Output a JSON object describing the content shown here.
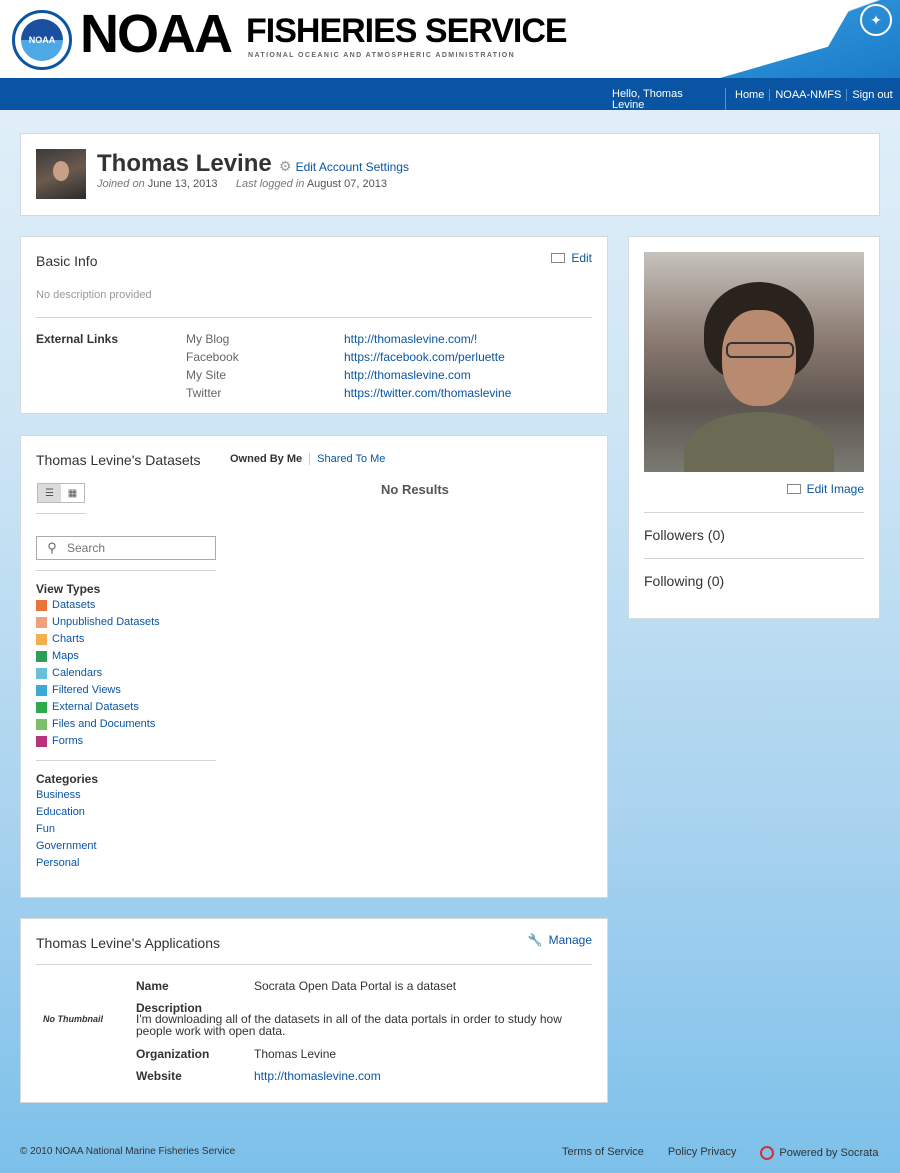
{
  "header": {
    "logo_text": "NOAA",
    "brand_main": "NOAA",
    "brand_secondary": "FISHERIES SERVICE",
    "brand_sub": "NATIONAL OCEANIC AND ATMOSPHERIC ADMINISTRATION"
  },
  "nav": {
    "greeting": "Hello, Thomas Levine",
    "links": [
      "Home",
      "NOAA-NMFS",
      "Sign out"
    ]
  },
  "profile": {
    "name": "Thomas Levine",
    "edit_account": "Edit Account Settings",
    "joined_label": "Joined on",
    "joined_date": "June 13, 2013",
    "last_logged_label": "Last logged in",
    "last_logged_date": "August 07, 2013"
  },
  "basic_info": {
    "title": "Basic Info",
    "edit_label": "Edit",
    "description": "No description provided",
    "external_links_label": "External Links",
    "links": [
      {
        "name": "My Blog",
        "url": "http://thomaslevine.com/!"
      },
      {
        "name": "Facebook",
        "url": "https://facebook.com/perluette"
      },
      {
        "name": "My Site",
        "url": "http://thomaslevine.com"
      },
      {
        "name": "Twitter",
        "url": "https://twitter.com/thomaslevine"
      }
    ]
  },
  "datasets": {
    "title": "Thomas Levine's Datasets",
    "tabs": [
      "Owned By Me",
      "Shared To Me"
    ],
    "no_results": "No Results",
    "search_placeholder": "Search",
    "view_types_label": "View Types",
    "view_types": [
      {
        "label": "Datasets",
        "color": "#e8743b",
        "icon": "grid-icon"
      },
      {
        "label": "Unpublished Datasets",
        "color": "#f0a07a",
        "icon": "draft-icon"
      },
      {
        "label": "Charts",
        "color": "#f4b04f",
        "icon": "chart-icon"
      },
      {
        "label": "Maps",
        "color": "#2e9e5b",
        "icon": "map-icon"
      },
      {
        "label": "Calendars",
        "color": "#6bbfd9",
        "icon": "calendar-icon"
      },
      {
        "label": "Filtered Views",
        "color": "#3fa9d6",
        "icon": "filter-icon"
      },
      {
        "label": "External Datasets",
        "color": "#2fa84f",
        "icon": "external-icon"
      },
      {
        "label": "Files and Documents",
        "color": "#7bbf6a",
        "icon": "file-icon"
      },
      {
        "label": "Forms",
        "color": "#b7337a",
        "icon": "form-icon"
      }
    ],
    "categories_label": "Categories",
    "categories": [
      "Business",
      "Education",
      "Fun",
      "Government",
      "Personal"
    ]
  },
  "applications": {
    "title": "Thomas Levine's Applications",
    "manage_label": "Manage",
    "no_thumbnail": "No Thumbnail",
    "name_label": "Name",
    "name_value": "Socrata Open Data Portal is a dataset",
    "description_label": "Description",
    "description_value": "I'm downloading all of the datasets in all of the data portals in order to study how people work with open data.",
    "organization_label": "Organization",
    "organization_value": "Thomas Levine",
    "website_label": "Website",
    "website_value": "http://thomaslevine.com"
  },
  "sidebar": {
    "edit_image": "Edit Image",
    "followers": "Followers (0)",
    "following": "Following (0)"
  },
  "footer": {
    "copyright": "© 2010 NOAA National Marine Fisheries Service",
    "terms": "Terms of Service",
    "privacy": "Policy Privacy",
    "powered": "Powered by Socrata"
  },
  "colors": {
    "nav_blue": "#0a55a3",
    "link_blue": "#0a55a3"
  }
}
